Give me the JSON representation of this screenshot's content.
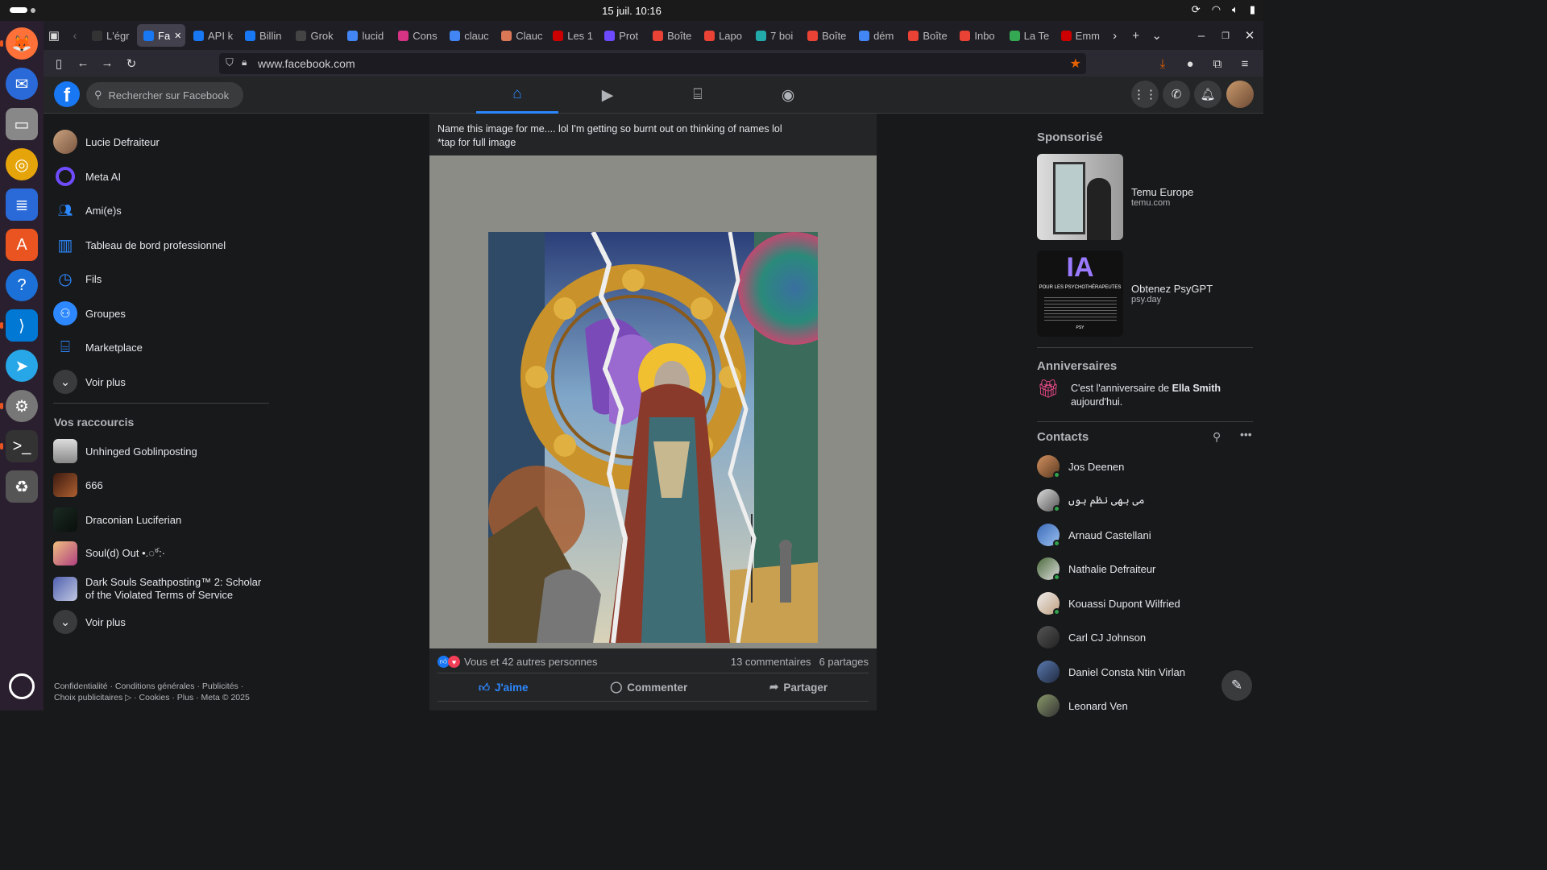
{
  "system": {
    "datetime": "15 juil.  10:16"
  },
  "browser": {
    "tabs": [
      {
        "label": "L'égr",
        "color": "#333"
      },
      {
        "label": "Fa",
        "color": "#1877f2"
      },
      {
        "label": "API k",
        "color": "#1877f2"
      },
      {
        "label": "Billin",
        "color": "#1877f2"
      },
      {
        "label": "Grok",
        "color": "#444"
      },
      {
        "label": "lucid",
        "color": "#4285f4"
      },
      {
        "label": "Cons",
        "color": "#d63384"
      },
      {
        "label": "clauc",
        "color": "#4285f4"
      },
      {
        "label": "Clauc",
        "color": "#d97757"
      },
      {
        "label": "Les 1",
        "color": "#c00"
      },
      {
        "label": "Prot",
        "color": "#6d4aff"
      },
      {
        "label": "Boîte",
        "color": "#ea4335"
      },
      {
        "label": "Lapo",
        "color": "#ea4335"
      },
      {
        "label": "7 boi",
        "color": "#2aa"
      },
      {
        "label": "Boîte",
        "color": "#ea4335"
      },
      {
        "label": "dém",
        "color": "#4285f4"
      },
      {
        "label": "Boîte",
        "color": "#ea4335"
      },
      {
        "label": "Inbo",
        "color": "#ea4335"
      },
      {
        "label": "La Te",
        "color": "#34a853"
      },
      {
        "label": "Emm",
        "color": "#c00"
      }
    ],
    "url": "www.facebook.com"
  },
  "fb": {
    "search_placeholder": "Rechercher sur Facebook",
    "left_menu": [
      "Lucie Defraiteur",
      "Meta AI",
      "Ami(e)s",
      "Tableau de bord professionnel",
      "Fils",
      "Groupes",
      "Marketplace",
      "Voir plus"
    ],
    "shortcuts_title": "Vos raccourcis",
    "shortcuts": [
      "Unhinged Goblinposting",
      "666",
      "Draconian Luciferian",
      "Soul(d) Out •.◌ۜ°:·",
      "Dark Souls Seathposting™ 2: Scholar of the Violated Terms of Service",
      "Voir plus"
    ],
    "footer_line1": "Confidentialité · Conditions générales · Publicités ·",
    "footer_line2": "Choix publicitaires ▷ · Cookies · Plus · Meta © 2025",
    "post": {
      "text1": "Name this image for me.... lol I'm getting so burnt out on thinking of names lol",
      "text2": "*tap for full image",
      "reactions_text": "Vous et 42 autres personnes",
      "comments": "13 commentaires",
      "shares": "6 partages",
      "like_label": "J'aime",
      "comment_label": "Commenter",
      "share_label": "Partager"
    },
    "sponsored_title": "Sponsorisé",
    "ads": [
      {
        "name": "Temu Europe",
        "domain": "temu.com"
      },
      {
        "name": "Obtenez PsyGPT",
        "domain": "psy.day",
        "thumb_title": "IA",
        "thumb_sub": "POUR LES PSYCHOTHÉRAPEUTES",
        "thumb_foot": "PSY"
      }
    ],
    "birthdays_title": "Anniversaires",
    "birthday_prefix": "C'est l'anniversaire de ",
    "birthday_name": "Ella Smith",
    "birthday_suffix": "aujourd'hui.",
    "contacts_title": "Contacts",
    "contacts": [
      "Jos Deenen",
      "می بھی نظم ہوں",
      "Arnaud Castellani",
      "Nathalie Defraiteur",
      "Kouassi Dupont Wilfried",
      "Carl CJ Johnson",
      "Daniel Consta Ntin Virlan",
      "Leonard Ven"
    ]
  }
}
